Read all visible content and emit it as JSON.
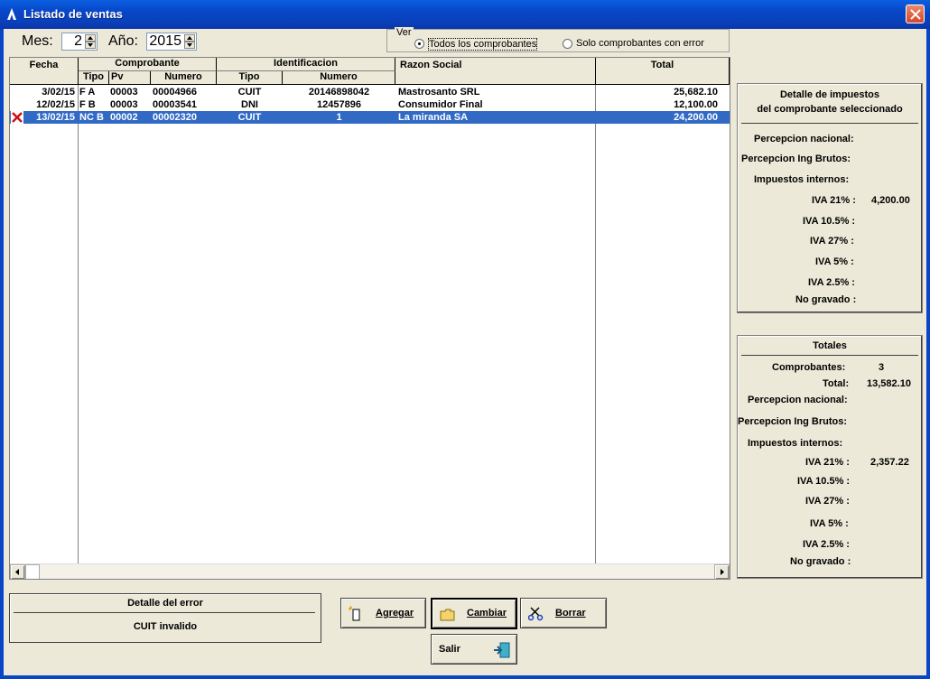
{
  "window": {
    "title": "Listado de ventas"
  },
  "filters": {
    "mes_label": "Mes:",
    "mes_value": "2",
    "anio_label": "Año:",
    "anio_value": "2015",
    "ver_legend": "Ver",
    "radio_all": "Todos los comprobantes",
    "radio_error": "Solo comprobantes con error"
  },
  "grid": {
    "headers": {
      "fecha": "Fecha",
      "comprobante": "Comprobante",
      "tipo": "Tipo",
      "pv": "Pv",
      "numero": "Numero",
      "identificacion": "Identificacion",
      "id_tipo": "Tipo",
      "id_numero": "Numero",
      "razon": "Razon Social",
      "total": "Total"
    },
    "rows": [
      {
        "fecha": "3/02/15",
        "tipo": "F A",
        "pv": "00003",
        "numero": "00004966",
        "id_tipo": "CUIT",
        "id_numero": "20146898042",
        "razon": "Mastrosanto SRL",
        "total": "25,682.10",
        "error": false,
        "selected": false
      },
      {
        "fecha": "12/02/15",
        "tipo": "F B",
        "pv": "00003",
        "numero": "00003541",
        "id_tipo": "DNI",
        "id_numero": "12457896",
        "razon": "Consumidor Final",
        "total": "12,100.00",
        "error": false,
        "selected": false
      },
      {
        "fecha": "13/02/15",
        "tipo": "NC B",
        "pv": "00002",
        "numero": "00002320",
        "id_tipo": "CUIT",
        "id_numero": "1",
        "razon": "La miranda SA",
        "total": "24,200.00",
        "error": true,
        "selected": true
      }
    ]
  },
  "detalle": {
    "title1": "Detalle de impuestos",
    "title2": "del comprobante seleccionado",
    "perc_nac": "Percepcion nacional:",
    "perc_ib": "Percepcion Ing Brutos:",
    "imp_int": "Impuestos internos:",
    "iva21": "IVA 21% :",
    "iva21_val": "4,200.00",
    "iva105": "IVA 10.5% :",
    "iva27": "IVA 27% :",
    "iva5": "IVA 5% :",
    "iva25": "IVA 2.5% :",
    "no_grav": "No gravado :"
  },
  "totales": {
    "title": "Totales",
    "comprobantes": "Comprobantes:",
    "comprobantes_val": "3",
    "total": "Total:",
    "total_val": "13,582.10",
    "perc_nac": "Percepcion nacional:",
    "perc_ib": "Percepcion Ing Brutos:",
    "imp_int": "Impuestos internos:",
    "iva21": "IVA 21% :",
    "iva21_val": "2,357.22",
    "iva105": "IVA 10.5% :",
    "iva27": "IVA 27% :",
    "iva5": "IVA 5% :",
    "iva25": "IVA 2.5% :",
    "no_grav": "No gravado :"
  },
  "error_box": {
    "title": "Detalle del error",
    "message": "CUIT invalido"
  },
  "buttons": {
    "agregar": "Agregar",
    "cambiar": "Cambiar",
    "borrar": "Borrar",
    "salir": "Salir"
  },
  "colors": {
    "titlebar": "#0846c8",
    "selection": "#316ac5",
    "error_mark": "#d01010",
    "window_bg": "#ece9d8"
  }
}
